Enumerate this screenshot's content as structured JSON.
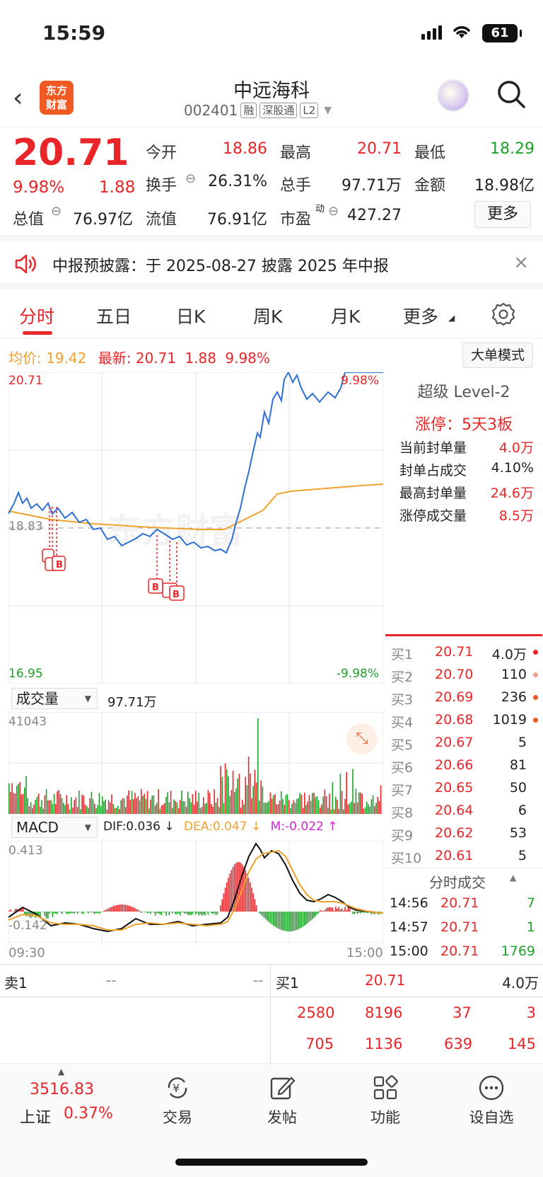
{
  "status": {
    "time": "15:59",
    "battery": "61"
  },
  "header": {
    "back": "‹",
    "logo": "东方财富",
    "name": "中远海科",
    "code": "002401",
    "tags": [
      "融",
      "深股通",
      "L2"
    ]
  },
  "quote": {
    "price": "20.71",
    "pct": "9.98%",
    "chg": "1.88",
    "open_label": "今开",
    "open": "18.86",
    "high_label": "最高",
    "high": "20.71",
    "low_label": "最低",
    "low": "18.29",
    "turnover_label": "换手",
    "turnover": "26.31%",
    "vol_label": "总手",
    "vol": "97.71万",
    "amount_label": "金额",
    "amount": "18.98亿",
    "mktcap_label": "总值",
    "mktcap": "76.97亿",
    "float_label": "流值",
    "float": "76.91亿",
    "pe_label": "市盈",
    "pe_sup": "动",
    "pe": "427.27",
    "more": "更多"
  },
  "notice": {
    "text": "中报预披露：于 2025-08-27 披露 2025 年中报",
    "close": "×"
  },
  "tabs": [
    "分时",
    "五日",
    "日K",
    "周K",
    "月K",
    "更多"
  ],
  "info": {
    "avg_label": "均价:",
    "avg": "19.42",
    "latest_label": "最新:",
    "latest": "20.71",
    "chg": "1.88",
    "pct": "9.98%",
    "big_mode": "大单模式"
  },
  "chart": {
    "top_price": "20.71",
    "top_pct": "9.98%",
    "mid_price": "18.83",
    "low_price": "16.95",
    "low_pct": "-9.98%",
    "watermark": "东方财富"
  },
  "level2": {
    "title": "超级 Level-2",
    "limit": "涨停：5天3板",
    "rows": [
      {
        "label": "当前封单量",
        "value": "4.0万"
      },
      {
        "label": "封单占成交",
        "value": "4.10%"
      },
      {
        "label": "最高封单量",
        "value": "24.6万"
      },
      {
        "label": "涨停成交量",
        "value": "8.5万"
      }
    ]
  },
  "bids": [
    {
      "label": "买1",
      "price": "20.71",
      "vol": "4.0万"
    },
    {
      "label": "买2",
      "price": "20.70",
      "vol": "110"
    },
    {
      "label": "买3",
      "price": "20.69",
      "vol": "236"
    },
    {
      "label": "买4",
      "price": "20.68",
      "vol": "1019"
    },
    {
      "label": "买5",
      "price": "20.67",
      "vol": "5"
    },
    {
      "label": "买6",
      "price": "20.66",
      "vol": "81"
    },
    {
      "label": "买7",
      "price": "20.65",
      "vol": "50"
    },
    {
      "label": "买8",
      "price": "20.64",
      "vol": "6"
    },
    {
      "label": "买9",
      "price": "20.62",
      "vol": "53"
    },
    {
      "label": "买10",
      "price": "20.61",
      "vol": "5"
    }
  ],
  "ticks": {
    "title": "分时成交",
    "rows": [
      {
        "time": "14:56",
        "price": "20.71",
        "vol": "7"
      },
      {
        "time": "14:57",
        "price": "20.71",
        "vol": "1"
      },
      {
        "time": "15:00",
        "price": "20.71",
        "vol": "1769"
      }
    ]
  },
  "volume": {
    "select": "成交量",
    "total": "97.71万",
    "max": "41043"
  },
  "macd": {
    "select": "MACD",
    "dif": "DIF:0.036 ↓",
    "dea": "DEA:0.047 ↓",
    "m": "M:-0.022 ↑",
    "max": "0.413",
    "min": "-0.142",
    "start": "09:30",
    "end": "15:00"
  },
  "book": {
    "sell_label": "卖1",
    "sell_price": "--",
    "sell_vol": "--",
    "buy_label": "买1",
    "buy_price": "20.71",
    "buy_vol": "4.0万",
    "row1": [
      "2580",
      "8196",
      "37",
      "3"
    ],
    "row2": [
      "705",
      "1136",
      "639",
      "145"
    ]
  },
  "bottom": {
    "index_value": "3516.83",
    "index_name": "上证",
    "index_pct": "0.37%",
    "items": [
      "交易",
      "发帖",
      "功能",
      "设自选"
    ]
  },
  "colors": {
    "up": "#e8262a",
    "down": "#1fa02a",
    "avg_line": "#f0a12c",
    "price_line": "#2f6fd6"
  }
}
